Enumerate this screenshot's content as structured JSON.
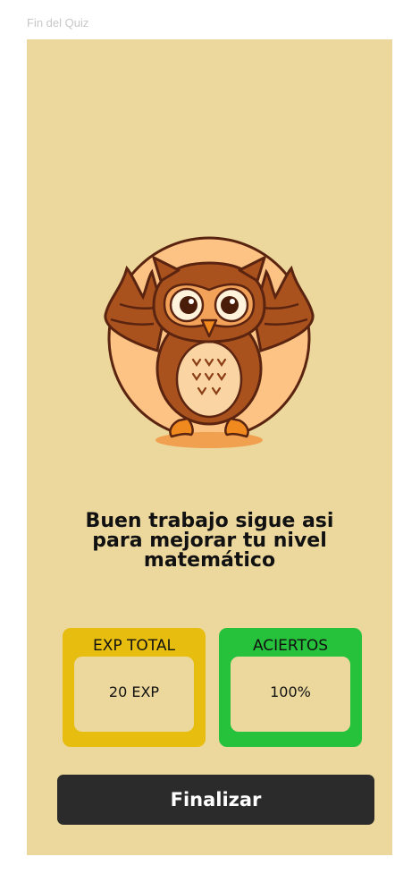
{
  "frame": {
    "title": "Fin del Quiz"
  },
  "mascot": {
    "icon": "owl-mascot-icon"
  },
  "message": {
    "line1": "Buen trabajo sigue asi",
    "line2": "para mejorar tu nivel",
    "line3": "matemático"
  },
  "stats": {
    "exp": {
      "label": "EXP TOTAL",
      "value": "20 EXP",
      "color": "#e7bd0f"
    },
    "hits": {
      "label": "ACIERTOS",
      "value": "100%",
      "color": "#27c23c"
    }
  },
  "actions": {
    "finish_label": "Finalizar"
  },
  "colors": {
    "background": "#ecd89d",
    "button": "#2b2b2b"
  }
}
